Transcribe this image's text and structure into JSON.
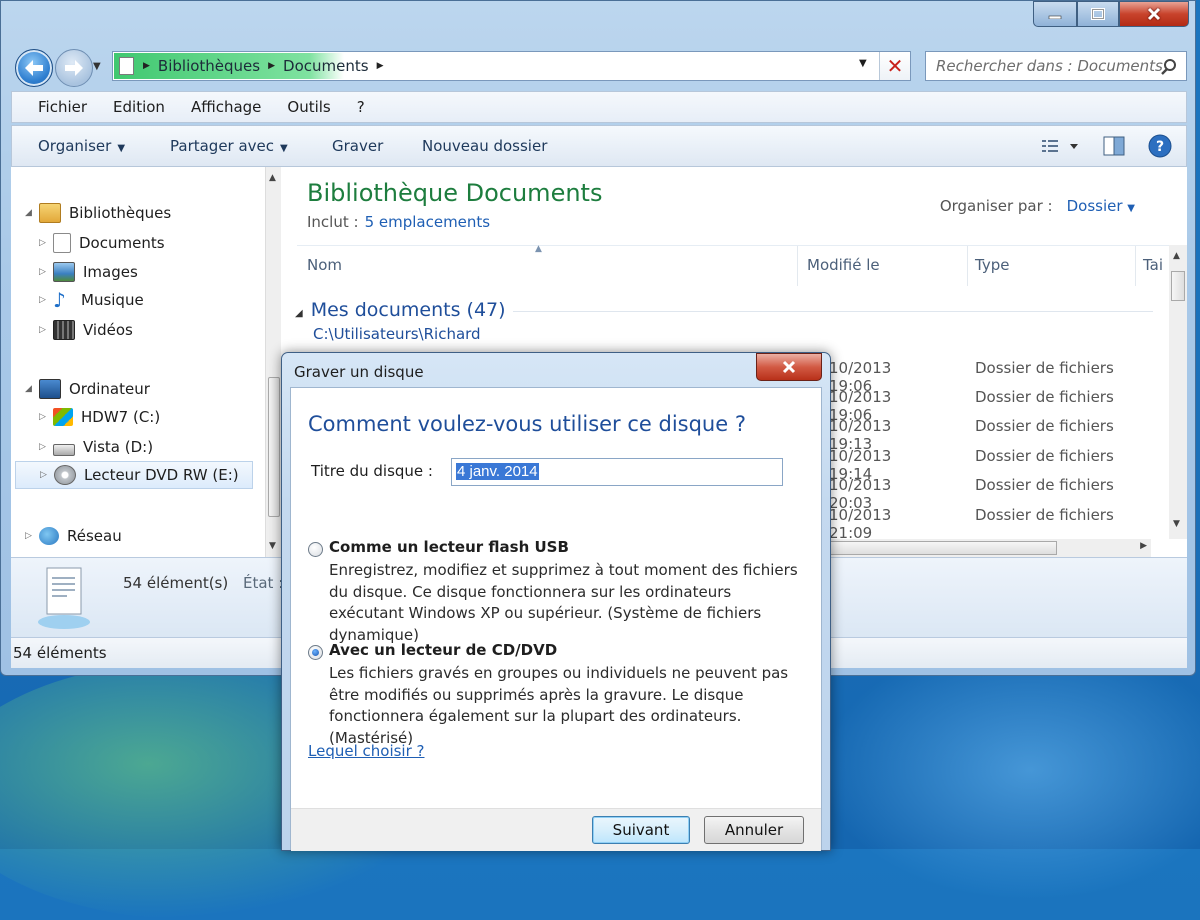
{
  "window": {
    "address": {
      "crumbs": [
        "Bibliothèques",
        "Documents"
      ]
    },
    "search_placeholder": "Rechercher dans : Documents"
  },
  "menubar": [
    "Fichier",
    "Edition",
    "Affichage",
    "Outils",
    "?"
  ],
  "commandbar": {
    "organiser": "Organiser",
    "partager": "Partager avec",
    "graver": "Graver",
    "nouveau_dossier": "Nouveau dossier"
  },
  "nav": {
    "libraries": "Bibliothèques",
    "lib_items": [
      "Documents",
      "Images",
      "Musique",
      "Vidéos"
    ],
    "computer": "Ordinateur",
    "drives": [
      "HDW7 (C:)",
      "Vista (D:)",
      "Lecteur DVD RW (E:)"
    ],
    "network": "Réseau"
  },
  "content": {
    "title": "Bibliothèque Documents",
    "include_label": "Inclut :",
    "include_link": "5 emplacements",
    "arrange_label": "Organiser par :",
    "arrange_value": "Dossier",
    "columns": [
      "Nom",
      "Modifié le",
      "Type",
      "Tai"
    ],
    "group_title": "Mes documents (47)",
    "group_path": "C:\\Utilisateurs\\Richard",
    "rows": [
      {
        "date": "10/2013 19:06",
        "type": "Dossier de fichiers"
      },
      {
        "date": "10/2013 19:06",
        "type": "Dossier de fichiers"
      },
      {
        "date": "10/2013 19:13",
        "type": "Dossier de fichiers"
      },
      {
        "date": "10/2013 19:14",
        "type": "Dossier de fichiers"
      },
      {
        "date": "10/2013 20:03",
        "type": "Dossier de fichiers"
      },
      {
        "date": "10/2013 21:09",
        "type": "Dossier de fichiers"
      }
    ]
  },
  "details": {
    "count": "54 élément(s)",
    "state": "État :"
  },
  "statusbar": "54 éléments",
  "dialog": {
    "title": "Graver un disque",
    "question": "Comment voulez-vous utiliser ce disque ?",
    "disc_title_label": "Titre du disque :",
    "disc_title_value": "4 janv. 2014",
    "option1_title": "Comme un lecteur flash USB",
    "option1_desc": "Enregistrez, modifiez et supprimez à tout moment des fichiers du disque. Ce disque fonctionnera sur les ordinateurs exécutant Windows XP ou supérieur. (Système de fichiers dynamique)",
    "option2_title": "Avec un lecteur de CD/DVD",
    "option2_desc": "Les fichiers gravés en groupes ou individuels ne peuvent pas être modifiés ou supprimés après la gravure. Le disque fonctionnera également sur la plupart des ordinateurs. (Mastérisé)",
    "selected_option": 2,
    "help_link": "Lequel choisir ?",
    "next": "Suivant",
    "cancel": "Annuler"
  },
  "colors": {
    "accent_blue": "#1f4e9a",
    "title_green": "#1d7d3e",
    "link": "#1f5fb4"
  }
}
